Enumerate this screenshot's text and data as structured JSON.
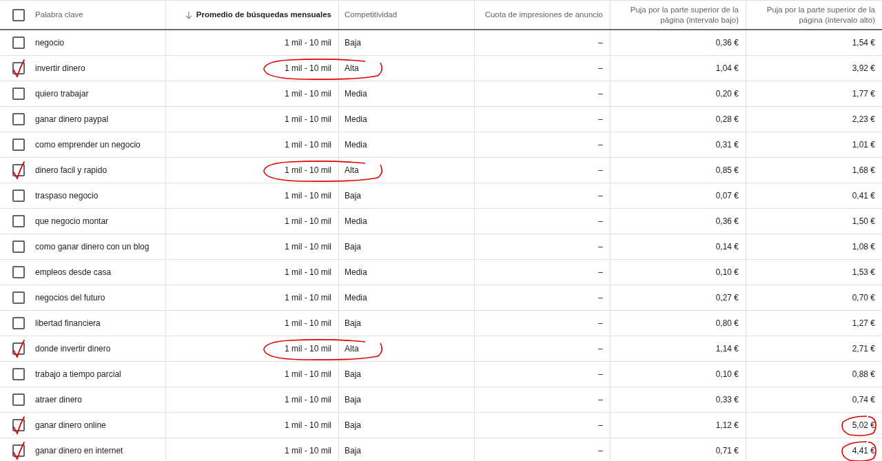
{
  "header": {
    "checked": false,
    "columns": [
      {
        "label": "Palabra clave",
        "sorted": false
      },
      {
        "label": "Promedio de búsquedas mensuales",
        "sorted": true
      },
      {
        "label": "Competitividad",
        "sorted": false
      },
      {
        "label": "Cuota de impresiones de anuncio",
        "sorted": false
      },
      {
        "label": "Puja por la parte superior de la página (intervalo bajo)",
        "sorted": false
      },
      {
        "label": "Puja por la parte superior de la página (intervalo alto)",
        "sorted": false
      }
    ]
  },
  "rows": [
    {
      "keyword": "negocio",
      "searches": "1 mil - 10 mil",
      "competition": "Baja",
      "share": "–",
      "low": "0,36 €",
      "high": "1,54 €",
      "ticked": false,
      "circled": false,
      "high_circled": false
    },
    {
      "keyword": "invertir dinero",
      "searches": "1 mil - 10 mil",
      "competition": "Alta",
      "share": "–",
      "low": "1,04 €",
      "high": "3,92 €",
      "ticked": true,
      "circled": true,
      "high_circled": false
    },
    {
      "keyword": "quiero trabajar",
      "searches": "1 mil - 10 mil",
      "competition": "Media",
      "share": "–",
      "low": "0,20 €",
      "high": "1,77 €",
      "ticked": false,
      "circled": false,
      "high_circled": false
    },
    {
      "keyword": "ganar dinero paypal",
      "searches": "1 mil - 10 mil",
      "competition": "Media",
      "share": "–",
      "low": "0,28 €",
      "high": "2,23 €",
      "ticked": false,
      "circled": false,
      "high_circled": false
    },
    {
      "keyword": "como emprender un negocio",
      "searches": "1 mil - 10 mil",
      "competition": "Media",
      "share": "–",
      "low": "0,31 €",
      "high": "1,01 €",
      "ticked": false,
      "circled": false,
      "high_circled": false
    },
    {
      "keyword": "dinero facil y rapido",
      "searches": "1 mil - 10 mil",
      "competition": "Alta",
      "share": "–",
      "low": "0,85 €",
      "high": "1,68 €",
      "ticked": true,
      "circled": true,
      "high_circled": false
    },
    {
      "keyword": "traspaso negocio",
      "searches": "1 mil - 10 mil",
      "competition": "Baja",
      "share": "–",
      "low": "0,07 €",
      "high": "0,41 €",
      "ticked": false,
      "circled": false,
      "high_circled": false
    },
    {
      "keyword": "que negocio montar",
      "searches": "1 mil - 10 mil",
      "competition": "Media",
      "share": "–",
      "low": "0,36 €",
      "high": "1,50 €",
      "ticked": false,
      "circled": false,
      "high_circled": false
    },
    {
      "keyword": "como ganar dinero con un blog",
      "searches": "1 mil - 10 mil",
      "competition": "Baja",
      "share": "–",
      "low": "0,14 €",
      "high": "1,08 €",
      "ticked": false,
      "circled": false,
      "high_circled": false
    },
    {
      "keyword": "empleos desde casa",
      "searches": "1 mil - 10 mil",
      "competition": "Media",
      "share": "–",
      "low": "0,10 €",
      "high": "1,53 €",
      "ticked": false,
      "circled": false,
      "high_circled": false
    },
    {
      "keyword": "negocios del futuro",
      "searches": "1 mil - 10 mil",
      "competition": "Media",
      "share": "–",
      "low": "0,27 €",
      "high": "0,70 €",
      "ticked": false,
      "circled": false,
      "high_circled": false
    },
    {
      "keyword": "libertad financiera",
      "searches": "1 mil - 10 mil",
      "competition": "Baja",
      "share": "–",
      "low": "0,80 €",
      "high": "1,27 €",
      "ticked": false,
      "circled": false,
      "high_circled": false
    },
    {
      "keyword": "donde invertir dinero",
      "searches": "1 mil - 10 mil",
      "competition": "Alta",
      "share": "–",
      "low": "1,14 €",
      "high": "2,71 €",
      "ticked": true,
      "circled": true,
      "high_circled": false
    },
    {
      "keyword": "trabajo a tiempo parcial",
      "searches": "1 mil - 10 mil",
      "competition": "Baja",
      "share": "–",
      "low": "0,10 €",
      "high": "0,88 €",
      "ticked": false,
      "circled": false,
      "high_circled": false
    },
    {
      "keyword": "atraer dinero",
      "searches": "1 mil - 10 mil",
      "competition": "Baja",
      "share": "–",
      "low": "0,33 €",
      "high": "0,74 €",
      "ticked": false,
      "circled": false,
      "high_circled": false
    },
    {
      "keyword": "ganar dinero online",
      "searches": "1 mil - 10 mil",
      "competition": "Baja",
      "share": "–",
      "low": "1,12 €",
      "high": "5,02 €",
      "ticked": true,
      "circled": false,
      "high_circled": true
    },
    {
      "keyword": "ganar dinero en internet",
      "searches": "1 mil - 10 mil",
      "competition": "Baja",
      "share": "–",
      "low": "0,71 €",
      "high": "4,41 €",
      "ticked": true,
      "circled": false,
      "high_circled": true
    }
  ]
}
